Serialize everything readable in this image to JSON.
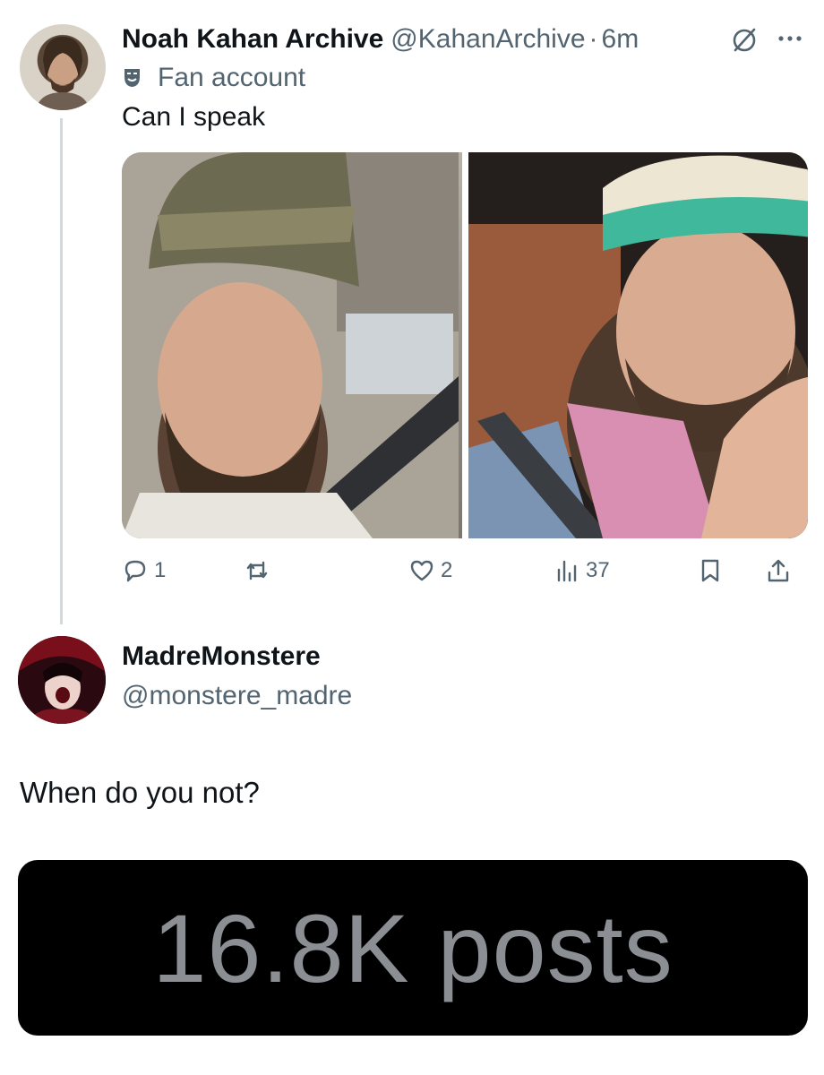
{
  "tweet": {
    "display_name": "Noah Kahan Archive",
    "handle": "@KahanArchive",
    "separator": "·",
    "time": "6m",
    "label": "Fan account",
    "text": "Can I speak",
    "actions": {
      "reply_count": "1",
      "repost_count": "",
      "like_count": "2",
      "view_count": "37"
    }
  },
  "reply": {
    "display_name": "MadreMonstere",
    "handle": "@monstere_madre",
    "text": "When do you not?"
  },
  "banner": {
    "text": "16.8K posts"
  },
  "colors": {
    "text_primary": "#0f1419",
    "text_secondary": "#536471",
    "thread_line": "#cfd9de",
    "banner_bg": "#000000",
    "banner_text": "#8b8f94"
  },
  "icons": {
    "label_icon": "theater-mask-icon",
    "grok": "grok-icon",
    "more": "more-icon",
    "reply": "reply-icon",
    "repost": "repost-icon",
    "like": "heart-icon",
    "views": "views-icon",
    "bookmark": "bookmark-icon",
    "share": "share-icon"
  }
}
